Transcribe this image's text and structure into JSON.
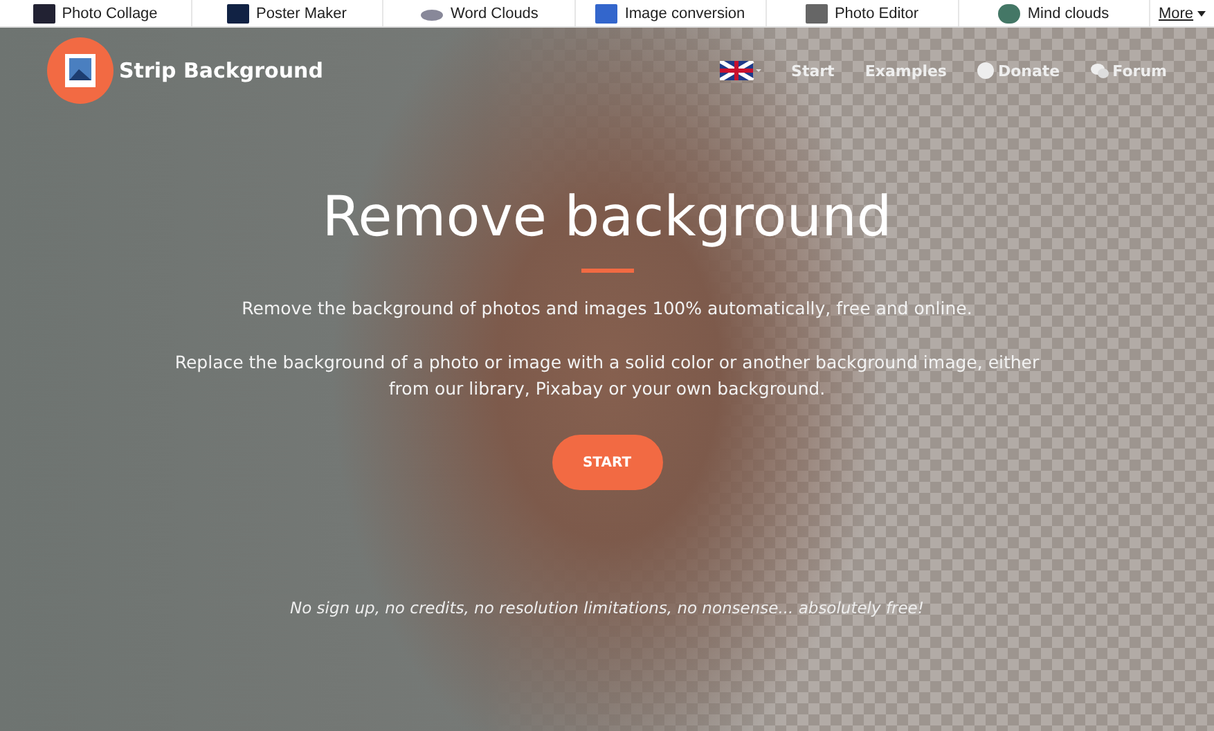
{
  "top_links": [
    {
      "label": "Photo Collage"
    },
    {
      "label": "Poster Maker"
    },
    {
      "label": "Word Clouds"
    },
    {
      "label": "Image conversion"
    },
    {
      "label": "Photo Editor"
    },
    {
      "label": "Mind clouds"
    }
  ],
  "more": {
    "label": "More"
  },
  "brand": {
    "name": "Strip Background"
  },
  "nav": [
    {
      "label": "Start"
    },
    {
      "label": "Examples"
    },
    {
      "label": "Donate"
    },
    {
      "label": "Forum"
    }
  ],
  "hero": {
    "title": "Remove background",
    "lead": "Remove the background of photos and images 100% automatically, free and online.",
    "text": "Replace the background of a photo or image with a solid color or another background image, either from our library, Pixabay or your own background.",
    "button": "START",
    "footnote": "No sign up, no credits, no resolution limitations, no nonsense... absolutely free!"
  }
}
